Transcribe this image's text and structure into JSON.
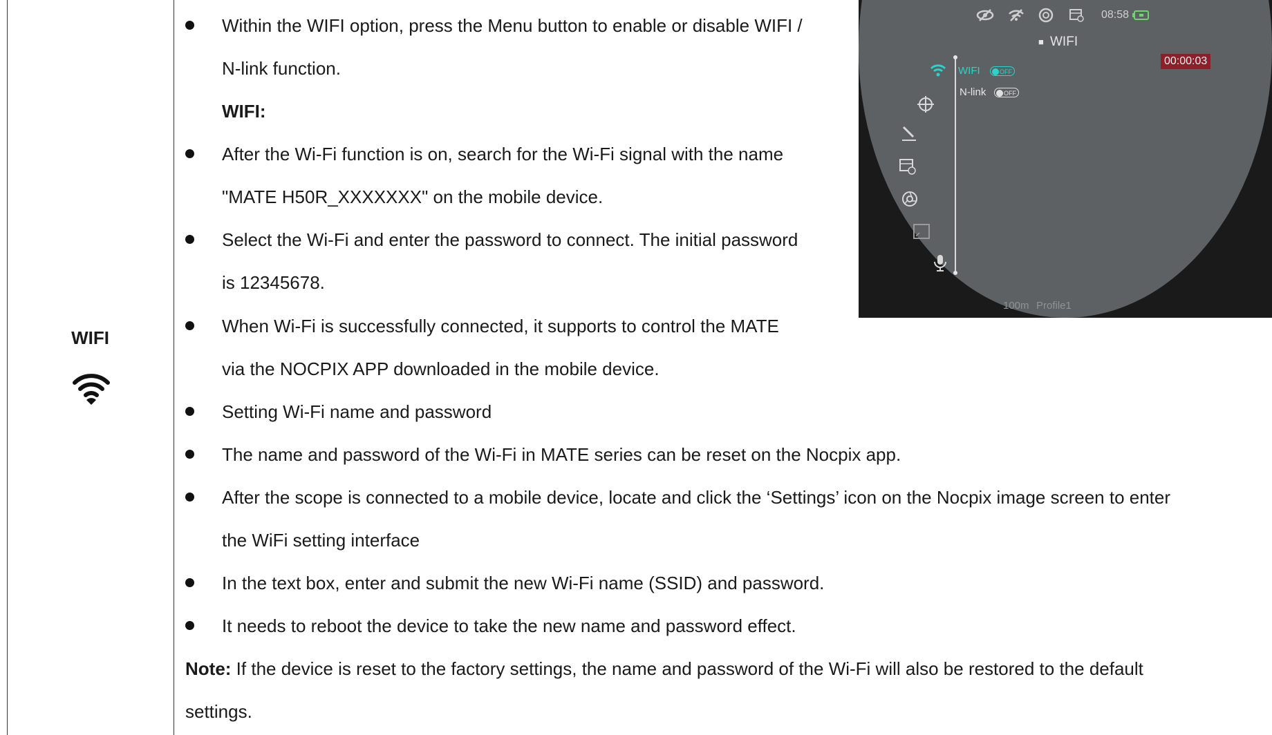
{
  "left_cell": {
    "title": "WIFI",
    "icon": "wifi-icon"
  },
  "content": {
    "bullet1_line1": "Within the WIFI option, press the Menu button to enable or disable WIFI /",
    "bullet1_line2": "N-link function.",
    "wifi_heading": "WIFI:",
    "bullet2_line1": "After the Wi-Fi function is on, search for the Wi-Fi signal with the name",
    "bullet2_line2": "\"MATE H50R_XXXXXXX\" on the mobile device.",
    "bullet3_line1": "Select the Wi-Fi and enter the password to connect. The initial password",
    "bullet3_line2": "is 12345678.",
    "bullet4_line1": "When Wi-Fi is successfully connected, it supports to control the MATE",
    "bullet4_line2": "via the NOCPIX APP downloaded in the mobile device.",
    "bullet5": "Setting Wi-Fi name and password",
    "bullet6": "The name and password of the Wi-Fi in MATE series can be reset on the Nocpix app.",
    "bullet7_line1": "After the scope is connected to a mobile device, locate and click the ‘Settings’ icon on the Nocpix image screen to enter",
    "bullet7_line2": "the WiFi setting interface",
    "bullet8": "In the text box, enter and submit the new Wi-Fi name (SSID) and password.",
    "bullet9": "It needs to reboot the device to take the new name and password effect.",
    "note_label": "Note:",
    "note_line1": "If the device is reset to the factory settings, the name and password of the Wi-Fi will also be restored to the default",
    "note_line2": "settings."
  },
  "device_screen": {
    "time": "08:58",
    "menu_title": "WIFI",
    "recording_timer": "00:00:03",
    "wifi_item": "WIFI",
    "wifi_toggle": "OFF",
    "nlink_item": "N-link",
    "nlink_toggle": "OFF",
    "distance": "100m",
    "profile": "Profile1",
    "colors": {
      "accent": "#2ad4c8",
      "screen_bg": "#5d6163",
      "timer_bg": "#8c1f2a"
    },
    "menu_icons": [
      "wifi-icon",
      "crosshair-icon",
      "pen-icon",
      "film-icon",
      "aperture-icon",
      "frame-icon",
      "mic-icon"
    ]
  }
}
